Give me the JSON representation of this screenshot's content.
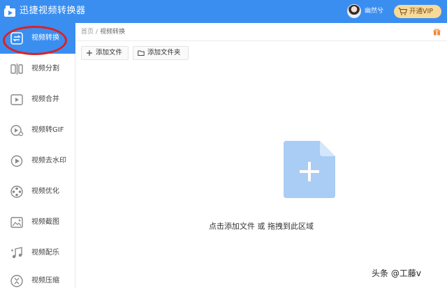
{
  "app": {
    "title": "迅捷视频转换器"
  },
  "header": {
    "username": "幽然兮",
    "vip_label": "开通VIP",
    "vip_color": "#f7d99a",
    "brand_color": "#3a8ef0"
  },
  "sidebar": {
    "items": [
      {
        "label": "视频转换",
        "icon": "convert-icon",
        "active": true
      },
      {
        "label": "视频分割",
        "icon": "split-icon"
      },
      {
        "label": "视频合并",
        "icon": "merge-icon"
      },
      {
        "label": "视频转GIF",
        "icon": "gif-icon"
      },
      {
        "label": "视频去水印",
        "icon": "watermark-remove-icon"
      },
      {
        "label": "视频优化",
        "icon": "optimize-icon"
      },
      {
        "label": "视频截图",
        "icon": "screenshot-icon"
      },
      {
        "label": "视频配乐",
        "icon": "music-icon"
      },
      {
        "label": "视频压缩",
        "icon": "compress-icon"
      }
    ]
  },
  "breadcrumb": {
    "home": "首页",
    "separator": "/",
    "current": "视频转换"
  },
  "toolbar": {
    "add_file_label": "添加文件",
    "add_folder_label": "添加文件夹"
  },
  "drop_zone": {
    "hint": "点击添加文件 或 拖拽到此区域"
  },
  "watermark": {
    "text": "头条 @工藤v"
  }
}
